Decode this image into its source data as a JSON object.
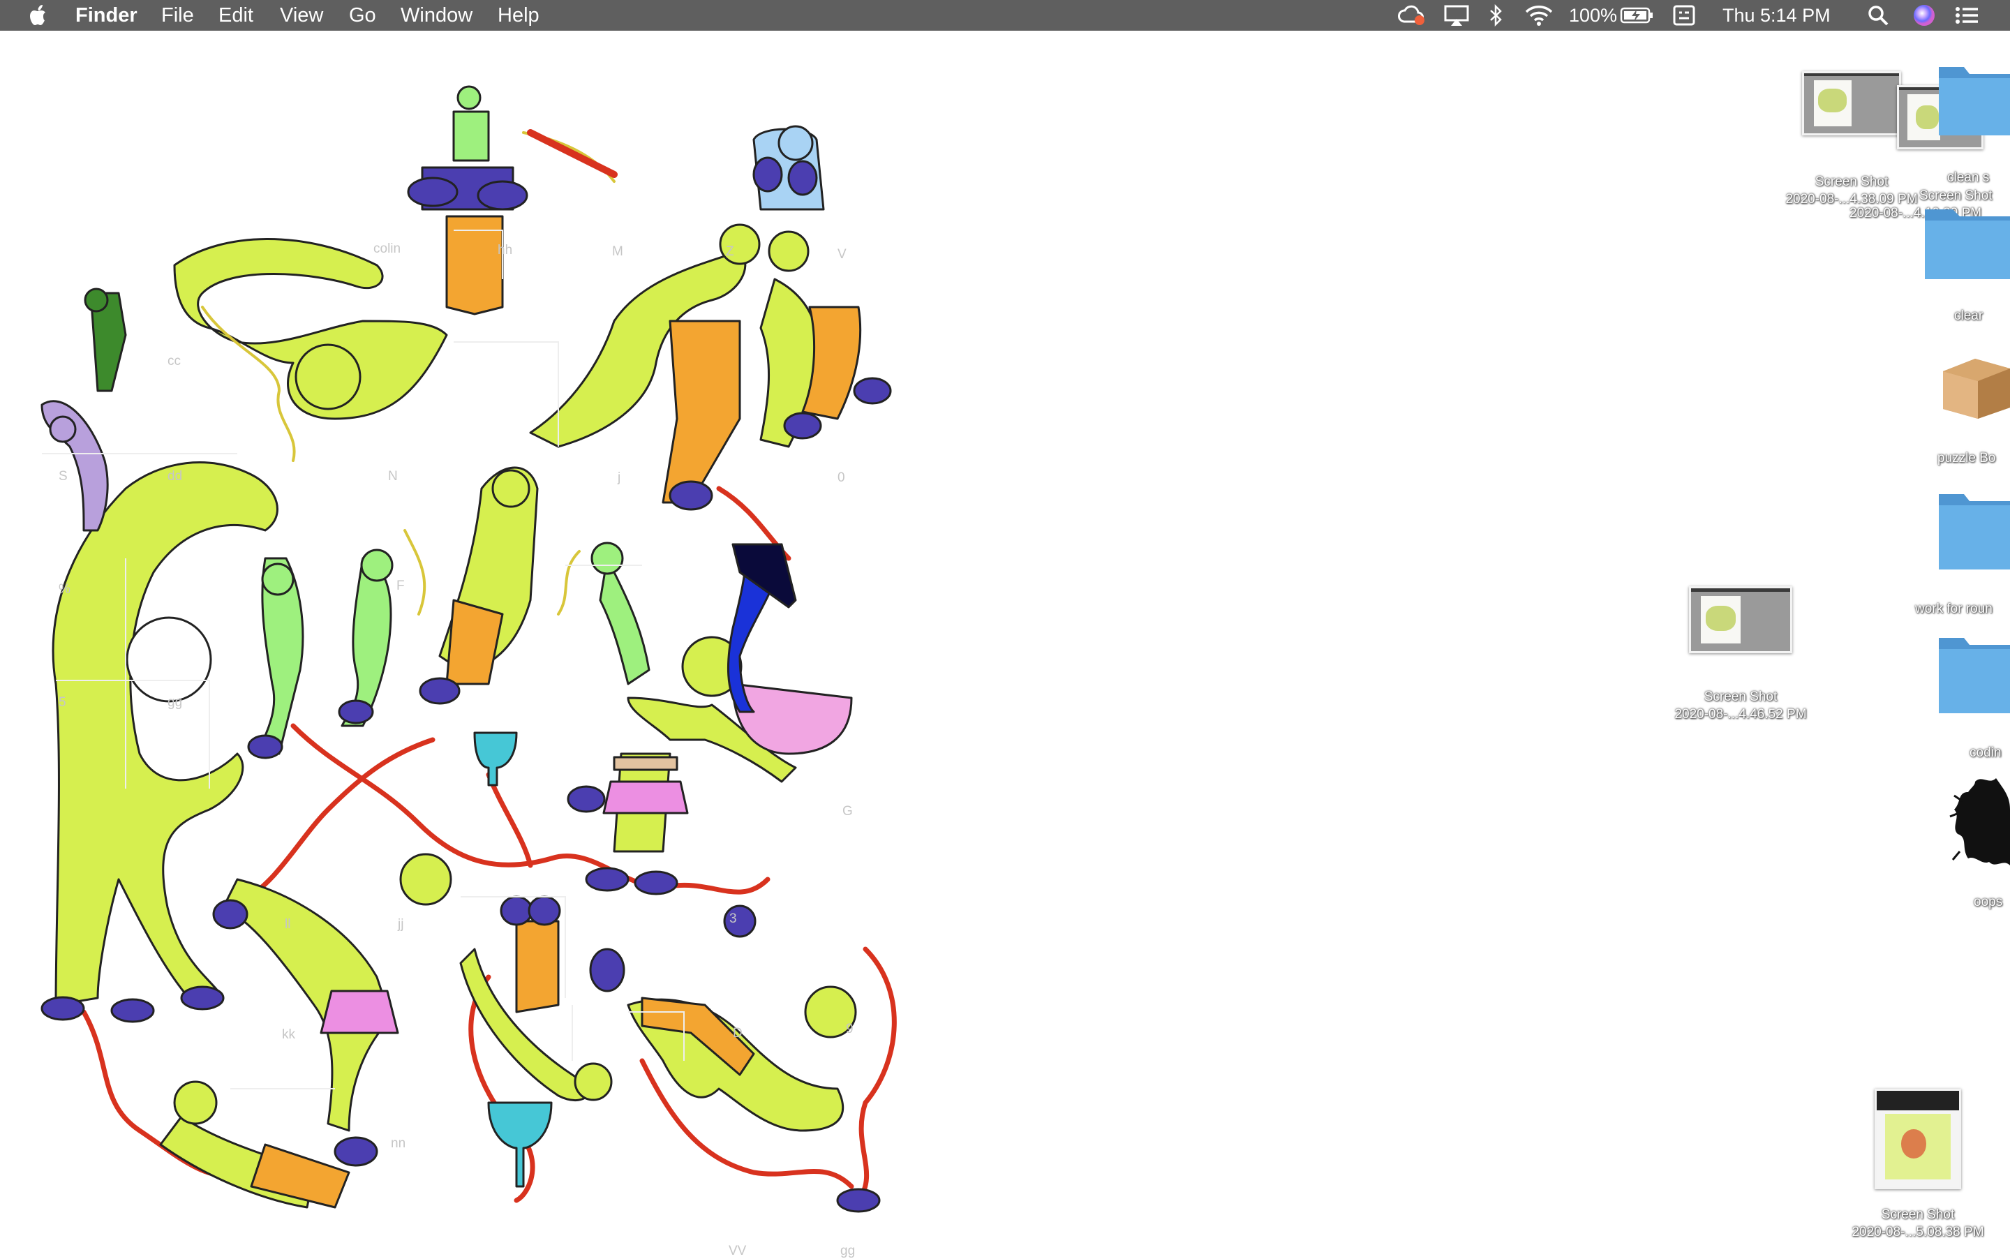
{
  "menubar": {
    "app_name": "Finder",
    "menus": [
      "File",
      "Edit",
      "View",
      "Go",
      "Window",
      "Help"
    ],
    "battery_percent": "100%",
    "clock": "Thu 5:14 PM",
    "status_icons": [
      "creative-cloud-icon",
      "airplay-icon",
      "bluetooth-icon",
      "wifi-icon",
      "battery-charging-icon",
      "keyboard-viewer-icon",
      "spotlight-search-icon",
      "siri-icon",
      "notification-center-icon"
    ]
  },
  "puzzle_labels": [
    "colin",
    "hh",
    "M",
    "Z",
    "V",
    "cc",
    "N",
    "j",
    "0",
    "S",
    "dd",
    "%",
    "F",
    "5",
    "gg",
    "G",
    "ll",
    "jj",
    "3",
    "kk",
    "D",
    "9",
    "nn",
    "VV",
    "gg"
  ],
  "desktop_icons": {
    "shot1": {
      "name_line1": "Screen Shot",
      "name_line2": "2020-08-...4.38.09 PM"
    },
    "shot2": {
      "name_line1": "Screen Shot",
      "name_line2": "2020-08-...4.10.39 PM"
    },
    "folder_clean": {
      "name": "clean s"
    },
    "folder_clear": {
      "name": "clear"
    },
    "box_puzzle": {
      "name": "puzzle Bo"
    },
    "folder_work": {
      "name": "work for roun"
    },
    "shot3": {
      "name_line1": "Screen Shot",
      "name_line2": "2020-08-...4.46.52 PM"
    },
    "folder_coding": {
      "name": "codin"
    },
    "splat": {
      "name": "oops"
    },
    "shot4": {
      "name_line1": "Screen Shot",
      "name_line2": "2020-08-...5.08.38 PM"
    }
  },
  "colors": {
    "menubar_bg": "#5f5f5f",
    "folder_blue": "#5ea6df",
    "figure_lime": "#d6ef4f",
    "figure_green": "#9ef07e",
    "ribbon_red": "#d8321e",
    "shoe_purple": "#4b3eb0",
    "pants_orange": "#f3a531",
    "skirt_pink": "#ec8fe2"
  }
}
